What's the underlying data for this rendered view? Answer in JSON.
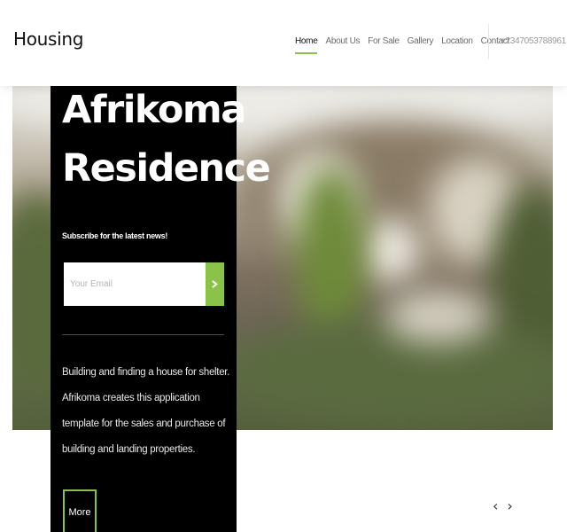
{
  "header": {
    "brand": "Housing",
    "nav": [
      {
        "label": "Home",
        "active": true
      },
      {
        "label": "About Us",
        "active": false
      },
      {
        "label": "For Sale",
        "active": false
      },
      {
        "label": "Gallery",
        "active": false
      },
      {
        "label": "Location",
        "active": false
      },
      {
        "label": "Contact",
        "active": false
      }
    ],
    "phone": "+2347053788961"
  },
  "hero": {
    "title_line1": "Afrikoma",
    "title_line2": "Residence",
    "subscribe_label": "Subscribe for the latest news!",
    "email_placeholder": "Your Email",
    "email_value": "",
    "submit_icon": "arrow-right-icon",
    "description": "Building and finding a house for shelter. Afrikoma creates this application template for the sales and purchase of building and landing properties.",
    "more_label": "More"
  },
  "carousel": {
    "prev_icon": "chevron-left-icon",
    "next_icon": "chevron-right-icon",
    "prev_glyph": "‹",
    "next_glyph": "›"
  },
  "colors": {
    "accent": "#8bc34a",
    "card_bg": "#000000",
    "header_bg": "#ffffff"
  }
}
